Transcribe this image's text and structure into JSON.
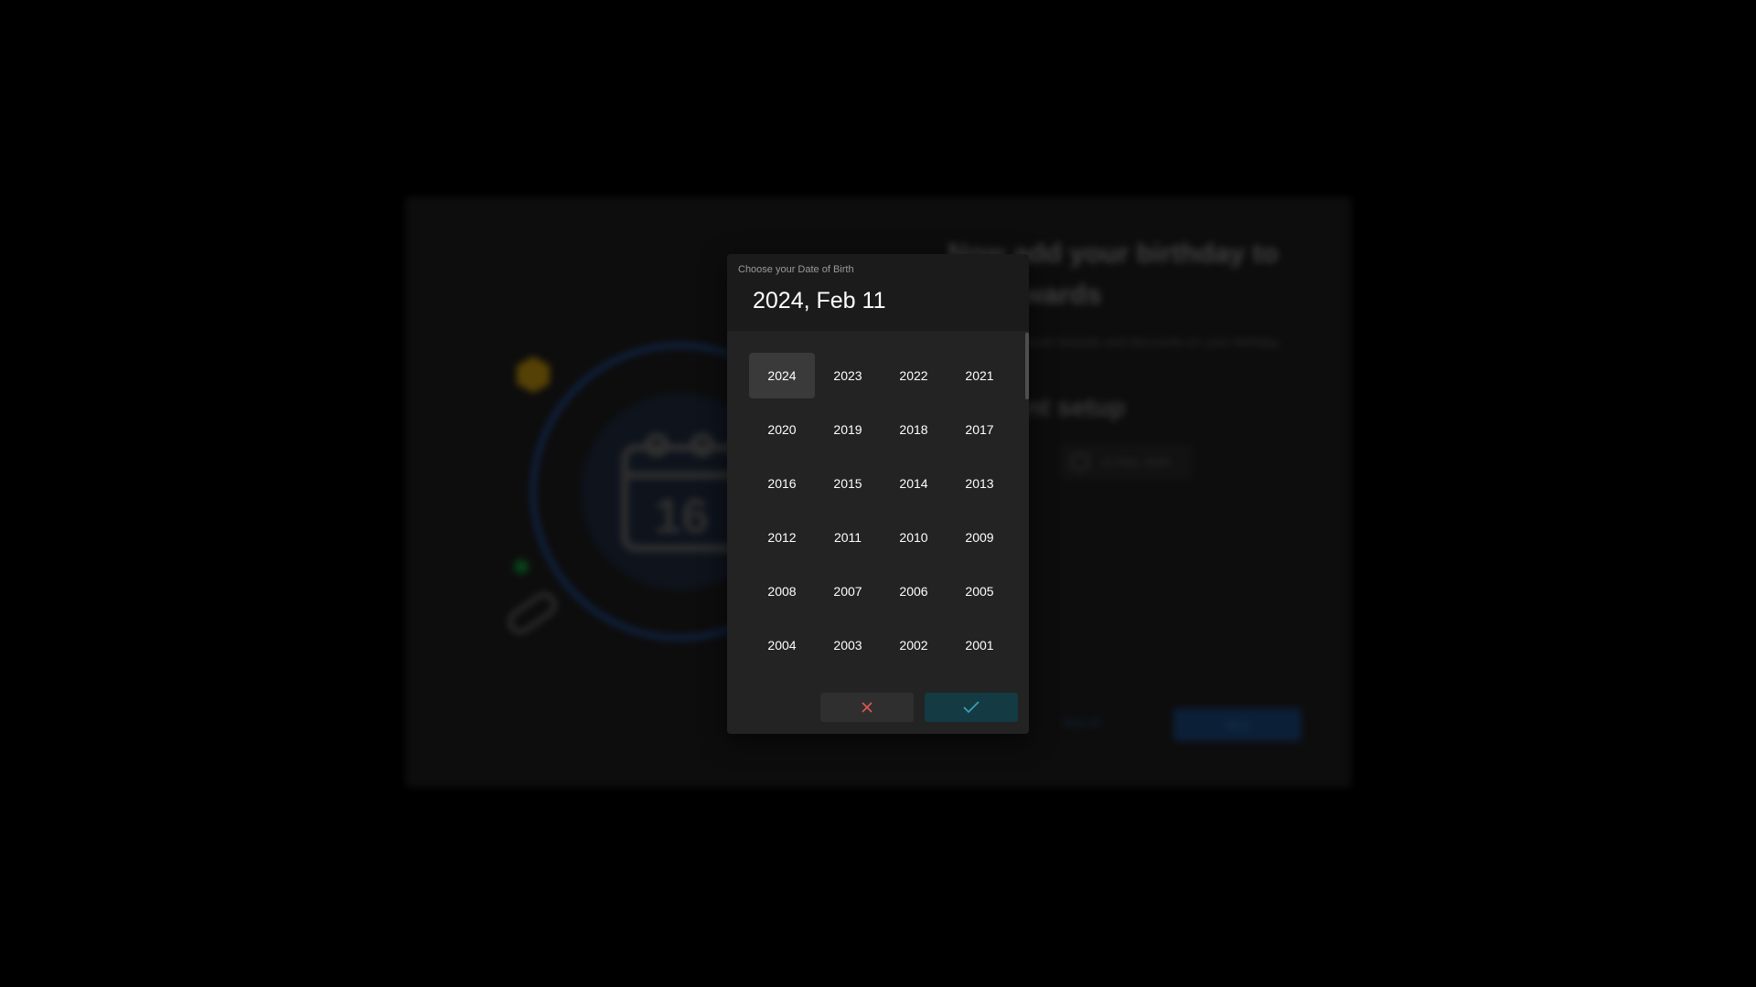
{
  "background": {
    "heading": "Now add your birthday to get rewards",
    "text": "Receive additional rewards and discounts on your birthday.",
    "subheading": "Account setup",
    "date_field_value": "11 Feb, 2024",
    "calendar_illustration_number": "16",
    "skip_label": "Skip all",
    "next_label": "Next"
  },
  "date_picker": {
    "caption": "Choose your Date of Birth",
    "selected_display": "2024, Feb 11",
    "selected_year": "2024",
    "years": [
      "2024",
      "2023",
      "2022",
      "2021",
      "2020",
      "2019",
      "2018",
      "2017",
      "2016",
      "2015",
      "2014",
      "2013",
      "2012",
      "2011",
      "2010",
      "2009",
      "2008",
      "2007",
      "2006",
      "2005",
      "2004",
      "2003",
      "2002",
      "2001"
    ],
    "cancel_icon": "close-icon",
    "confirm_icon": "checkmark-icon"
  },
  "colors": {
    "overlay": "#000000",
    "dialog_bg": "#232323",
    "dialog_header_bg": "#1b1b1b",
    "selected_year_bg": "#3a3a3a",
    "cancel_icon_color": "#e0574f",
    "confirm_bg": "#143a44",
    "confirm_icon_color": "#3c9fb2",
    "illustration_ring": "#1b3a6e",
    "illustration_yellow": "#8a6a0a",
    "illustration_green": "#0f6a2a"
  }
}
